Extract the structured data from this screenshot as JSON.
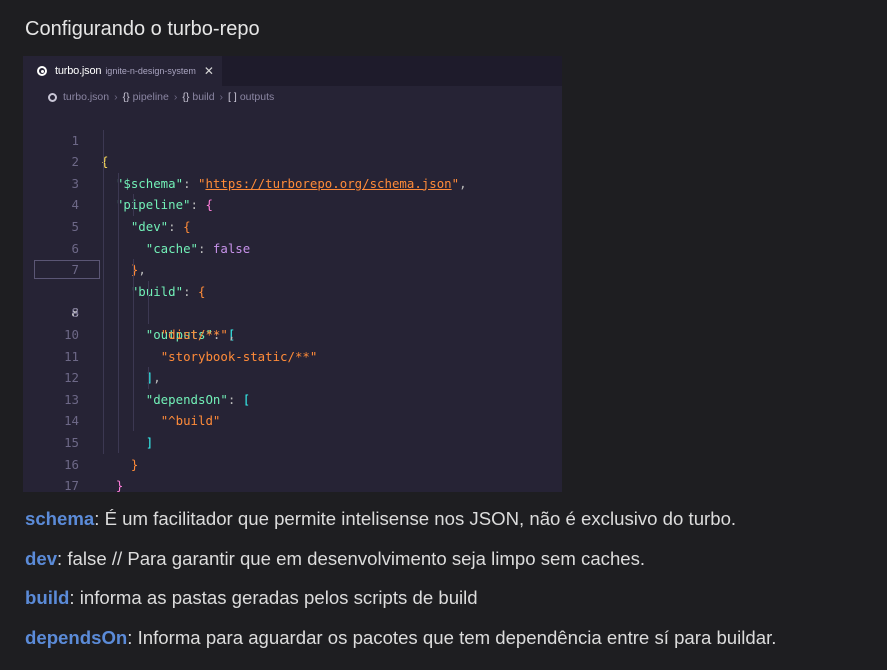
{
  "page": {
    "heading": "Configurando o turbo-repo"
  },
  "editor": {
    "tab": {
      "file_name": "turbo.json",
      "description": "ignite-n-design-system",
      "close_glyph": "✕"
    },
    "breadcrumb": {
      "file": "turbo.json",
      "items": [
        {
          "glyph": "{}",
          "label": "pipeline"
        },
        {
          "glyph": "{}",
          "label": "build"
        },
        {
          "glyph": "[ ]",
          "label": "outputs"
        }
      ]
    },
    "active_line": 8,
    "lines": [
      {
        "num": "1"
      },
      {
        "num": "2"
      },
      {
        "num": "3"
      },
      {
        "num": "4"
      },
      {
        "num": "5"
      },
      {
        "num": "6"
      },
      {
        "num": "7"
      },
      {
        "num": "8"
      },
      {
        "num": "9"
      },
      {
        "num": "10"
      },
      {
        "num": "11"
      },
      {
        "num": "12"
      },
      {
        "num": "13"
      },
      {
        "num": "14"
      },
      {
        "num": "15"
      },
      {
        "num": "16"
      },
      {
        "num": "17"
      }
    ],
    "code": {
      "schema_key": "\"$schema\"",
      "schema_url": "https://turborepo.org/schema.json",
      "pipeline_key": "\"pipeline\"",
      "dev_key": "\"dev\"",
      "cache_key": "\"cache\"",
      "cache_value": "false",
      "build_key": "\"build\"",
      "outputs_key": "\"outputs\"",
      "output_1": "\"dist/**\"",
      "output_2": "\"storybook-static/**\"",
      "depends_key": "\"dependsOn\"",
      "depends_1": "\"^build\""
    },
    "colors": {
      "background": "#262335",
      "tabbar": "#1e1b2b"
    }
  },
  "notes": [
    {
      "term": "schema",
      "desc": ": É um facilitador que permite intelisense nos JSON, não é exclusivo do turbo."
    },
    {
      "term": "dev",
      "desc": ": false // Para garantir que em desenvolvimento seja limpo sem caches."
    },
    {
      "term": "build",
      "desc": ": informa as pastas geradas pelos scripts de build"
    },
    {
      "term": "dependsOn",
      "desc": ": Informa para aguardar os pacotes que tem dependência entre sí para buildar."
    }
  ]
}
